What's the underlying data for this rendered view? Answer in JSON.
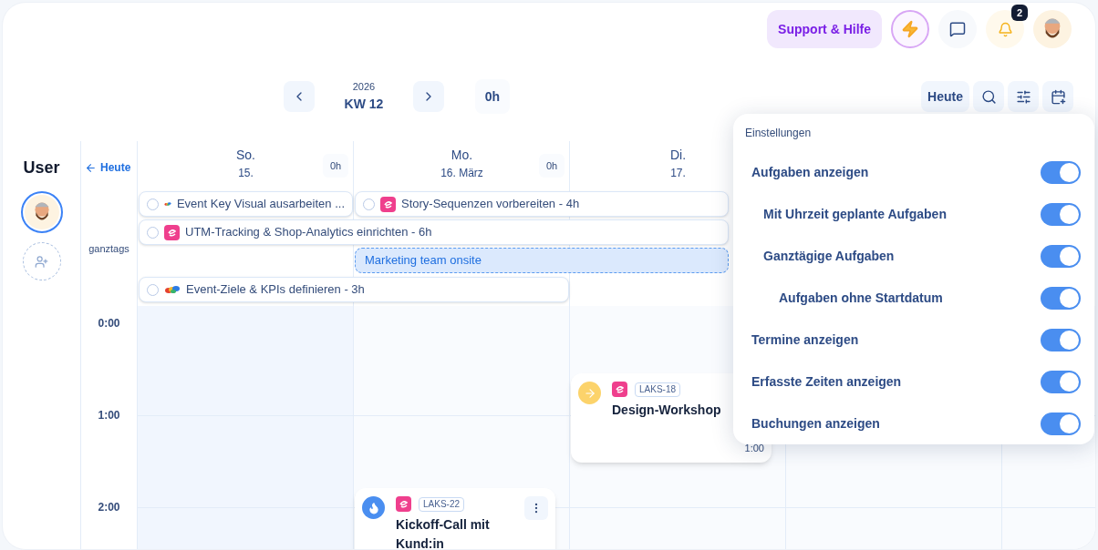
{
  "header": {
    "support_button": "Support & Hilfe",
    "notification_count": "2"
  },
  "nav": {
    "year": "2026",
    "week": "KW 12",
    "total": "0h",
    "today_button": "Heute"
  },
  "sidebar": {
    "title": "User",
    "today_link": "Heute",
    "allday_label": "ganztags"
  },
  "days": [
    {
      "name": "So.",
      "date": "15.",
      "hours": "0h"
    },
    {
      "name": "Mo.",
      "date": "16. März",
      "hours": "0h"
    },
    {
      "name": "Di.",
      "date": "17."
    }
  ],
  "hours": [
    "0:00",
    "1:00",
    "2:00"
  ],
  "all_day": [
    {
      "kind": "task",
      "title": "Event Key Visual ausarbeiten ...",
      "project": {
        "kind": "rainbow"
      },
      "checked": false
    },
    {
      "kind": "task",
      "title": "Story-Sequenzen vorbereiten - 4h",
      "project": {
        "kind": "pink"
      },
      "checked": false
    },
    {
      "kind": "task",
      "title": "UTM-Tracking & Shop-Analytics einrichten - 6h",
      "project": {
        "kind": "pink"
      },
      "checked": false
    },
    {
      "kind": "appointment",
      "title": "Marketing team onsite"
    },
    {
      "kind": "task",
      "title": "Event-Ziele & KPIs definieren - 3h",
      "project": {
        "kind": "rainbow"
      },
      "checked": false
    }
  ],
  "events": [
    {
      "title": "Design-Workshop",
      "ticket": "LAKS-18",
      "status": {
        "kind": "arrow"
      },
      "duration": "1:00",
      "menu": false
    },
    {
      "title": "Kickoff-Call mit Kund:in",
      "ticket": "LAKS-22",
      "status": {
        "kind": "flame"
      },
      "menu": true
    }
  ],
  "settings": {
    "title": "Einstellungen",
    "items": [
      {
        "label": "Aufgaben anzeigen",
        "on": true,
        "children": [
          {
            "label": "Mit Uhrzeit geplante Aufgaben",
            "on": true
          },
          {
            "label": "Ganztägige Aufgaben",
            "on": true,
            "children": [
              {
                "label": "Aufgaben ohne Startdatum",
                "on": true
              }
            ]
          }
        ]
      },
      {
        "label": "Termine anzeigen",
        "on": true
      },
      {
        "label": "Erfasste Zeiten anzeigen",
        "on": true
      },
      {
        "label": "Buchungen anzeigen",
        "on": true
      }
    ]
  }
}
